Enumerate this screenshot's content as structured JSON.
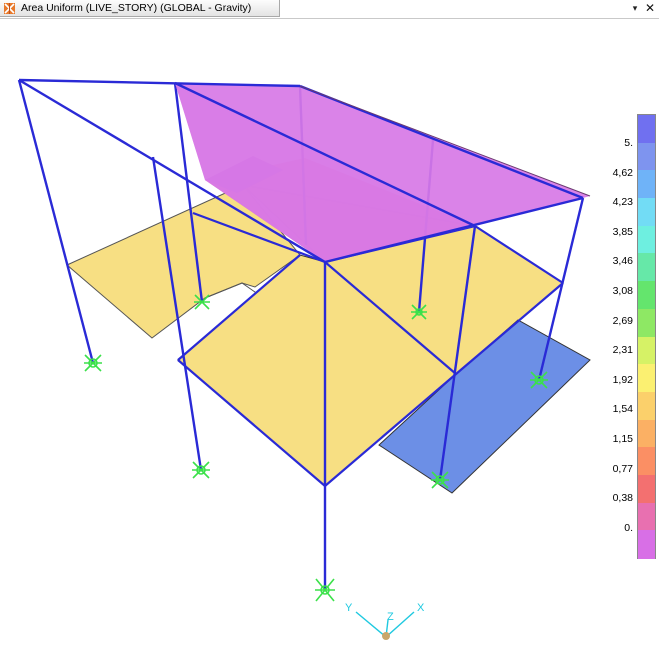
{
  "window": {
    "tab_title": "Area Uniform (LIVE_STORY) (GLOBAL - Gravity)",
    "dropdown_icon": "dropdown-arrow-icon",
    "dropdown_glyph": "▾",
    "close_icon": "close-icon",
    "close_glyph": "✕"
  },
  "legend": {
    "labels": [
      "5.",
      "4,62",
      "4,23",
      "3,85",
      "3,46",
      "3,08",
      "2,69",
      "2,31",
      "1,92",
      "1,54",
      "1,15",
      "0,77",
      "0,38",
      "0."
    ],
    "colors": [
      "#7070f0",
      "#7e94ef",
      "#6fb3f8",
      "#72dcf5",
      "#6eefe0",
      "#66e8a8",
      "#64e56d",
      "#8ee864",
      "#d6f266",
      "#fbf071",
      "#fbd06b",
      "#fbb064",
      "#fb8f64",
      "#f37070",
      "#e870b0",
      "#d86fe6"
    ]
  },
  "axes": {
    "x": "X",
    "y": "Y",
    "z": "Z"
  },
  "colors": {
    "frame": "#2a2ad6",
    "roof": "#d778e6",
    "floor": "#f7df83",
    "blue_slab": "#6c8fe6",
    "support": "#3be14a",
    "axis": "#1fc9e0"
  }
}
